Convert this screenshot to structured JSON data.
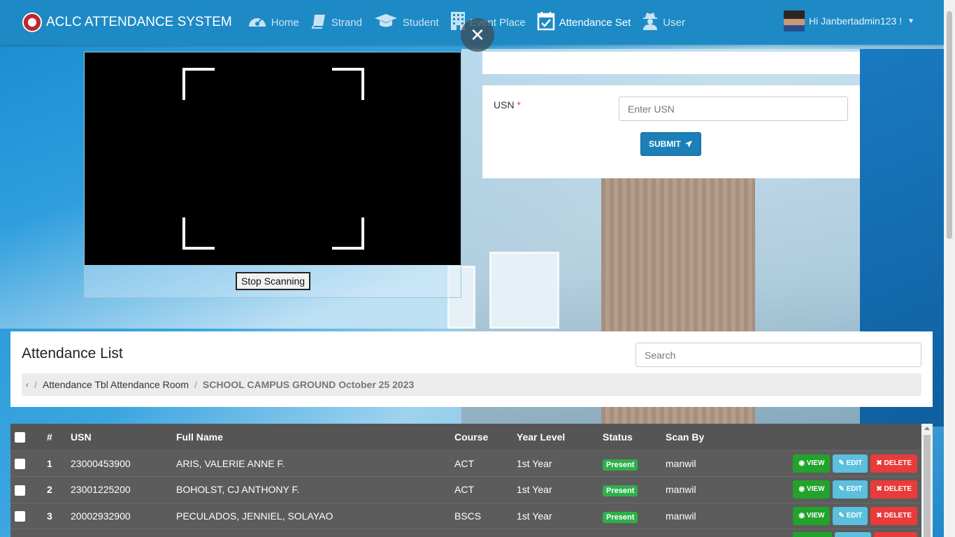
{
  "brand": {
    "title": "ACLC ATTENDANCE SYSTEM"
  },
  "nav": {
    "items": [
      {
        "label": "Home",
        "icon": "dashboard-icon"
      },
      {
        "label": "Strand",
        "icon": "book-icon"
      },
      {
        "label": "Student",
        "icon": "graduation-cap-icon"
      },
      {
        "label": "Event Place",
        "icon": "building-icon"
      },
      {
        "label": "Attendance Set",
        "icon": "calendar-check-icon"
      },
      {
        "label": "User",
        "icon": "user-secret-icon"
      }
    ],
    "active": "Attendance Set",
    "user_greeting": "Hi Janbertadmin123 !"
  },
  "scanner": {
    "stop_label": "Stop Scanning"
  },
  "form": {
    "usn_label": "USN",
    "required_mark": "*",
    "usn_placeholder": "Enter USN",
    "usn_value": "",
    "submit_label": "SUBMIT"
  },
  "list": {
    "title": "Attendance List",
    "search_placeholder": "Search",
    "breadcrumb": {
      "back": "‹",
      "parent": "Attendance Tbl Attendance Room",
      "current": "SCHOOL CAMPUS GROUND October 25 2023"
    }
  },
  "table": {
    "headers": {
      "num": "#",
      "usn": "USN",
      "name": "Full Name",
      "course": "Course",
      "year": "Year Level",
      "status": "Status",
      "scan_by": "Scan By"
    },
    "rows": [
      {
        "num": "1",
        "usn": "23000453900",
        "name": "ARIS, VALERIE ANNE F.",
        "course": "ACT",
        "year": "1st Year",
        "status": "Present",
        "scan_by": "manwil"
      },
      {
        "num": "2",
        "usn": "23001225200",
        "name": "BOHOLST, CJ ANTHONY F.",
        "course": "ACT",
        "year": "1st Year",
        "status": "Present",
        "scan_by": "manwil"
      },
      {
        "num": "3",
        "usn": "20002932900",
        "name": "PECULADOS, JENNIEL, SOLAYAO",
        "course": "BSCS",
        "year": "1st Year",
        "status": "Present",
        "scan_by": "manwil"
      }
    ],
    "actions": {
      "view": "VIEW",
      "edit": "EDIT",
      "delete": "DELETE"
    }
  },
  "colors": {
    "navbar": "#1d8ac6",
    "submit": "#1b7fb8",
    "view": "#21a32c",
    "edit": "#5bc0de",
    "delete": "#ea3b3b",
    "present": "#2db04a"
  }
}
